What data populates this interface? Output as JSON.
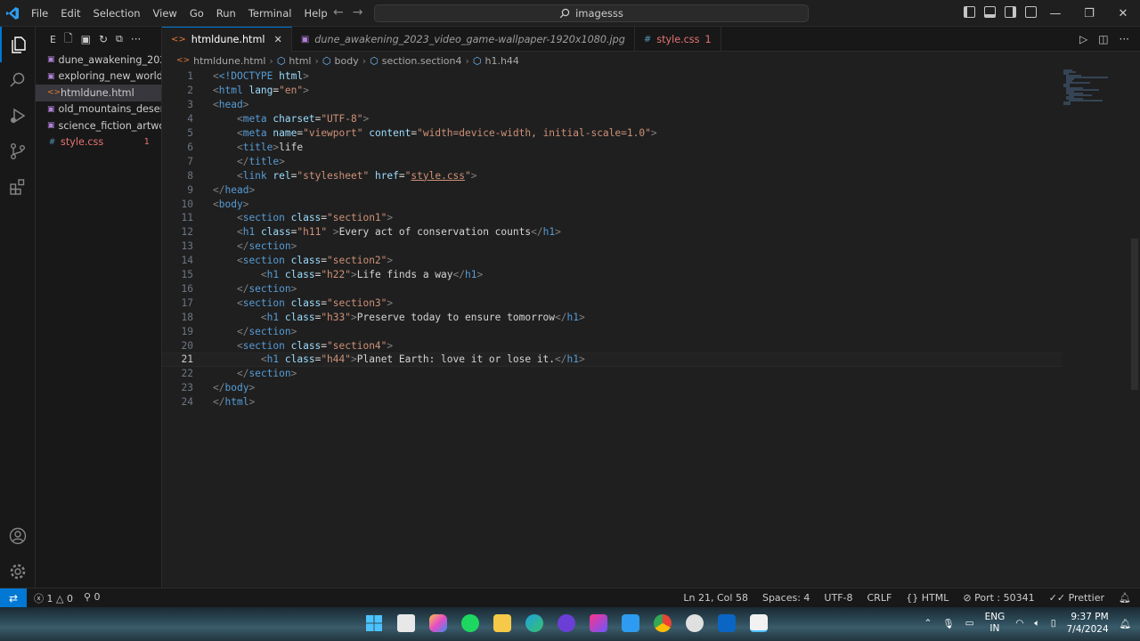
{
  "menu": [
    "File",
    "Edit",
    "Selection",
    "View",
    "Go",
    "Run",
    "Terminal",
    "Help"
  ],
  "search": {
    "text": "imagesss"
  },
  "sidebar": {
    "header_letter": "E",
    "files": [
      {
        "name": "dune_awakening_202...",
        "type": "image",
        "badge": ""
      },
      {
        "name": "exploring_new_world...",
        "type": "image",
        "badge": ""
      },
      {
        "name": "htmldune.html",
        "type": "html",
        "badge": ""
      },
      {
        "name": "old_mountains_deser...",
        "type": "image",
        "badge": ""
      },
      {
        "name": "science_fiction_artwor...",
        "type": "image",
        "badge": ""
      },
      {
        "name": "style.css",
        "type": "css",
        "badge": "1"
      }
    ]
  },
  "tabs": [
    {
      "label": "htmldune.html",
      "icon": "<>",
      "badge": ""
    },
    {
      "label": "dune_awakening_2023_video_game-wallpaper-1920x1080.jpg",
      "icon": "img",
      "badge": ""
    },
    {
      "label": "style.css",
      "icon": "#",
      "badge": "1"
    }
  ],
  "breadcrumb": [
    "htmldune.html",
    "html",
    "body",
    "section.section4",
    "h1.h44"
  ],
  "editor": {
    "current_line": 21,
    "lines": [
      {
        "n": "1"
      },
      {
        "n": "2"
      },
      {
        "n": "3"
      },
      {
        "n": "4"
      },
      {
        "n": "5"
      },
      {
        "n": "6"
      },
      {
        "n": "7"
      },
      {
        "n": "8"
      },
      {
        "n": "9"
      },
      {
        "n": "10"
      },
      {
        "n": "11"
      },
      {
        "n": "12"
      },
      {
        "n": "13"
      },
      {
        "n": "14"
      },
      {
        "n": "15"
      },
      {
        "n": "16"
      },
      {
        "n": "17"
      },
      {
        "n": "18"
      },
      {
        "n": "19"
      },
      {
        "n": "20"
      },
      {
        "n": "21"
      },
      {
        "n": "22"
      },
      {
        "n": "23"
      },
      {
        "n": "24"
      }
    ],
    "tokens": {
      "doctype": "<!DOCTYPE",
      "html_kw": "html",
      "lang_val": "\"en\"",
      "charset_val": "\"UTF-8\"",
      "viewport_val": "\"viewport\"",
      "content_val": "\"width=device-width, initial-scale=1.0\"",
      "title_text": "life",
      "stylesheet_val": "\"stylesheet\"",
      "href_val": "style.css",
      "s1": "\"section1\"",
      "h11": "\"h11\"",
      "t1": "Every act of conservation counts",
      "s2": "\"section2\"",
      "h22": "\"h22\"",
      "t2": "Life finds a way",
      "s3": "\"section3\"",
      "h33": "\"h33\"",
      "t3": "Preserve today to ensure tomorrow",
      "s4": "\"section4\"",
      "h44": "\"h44\"",
      "t4": "Planet Earth: love it or lose it."
    }
  },
  "status": {
    "errors": "1",
    "warnings": "0",
    "ports": "0",
    "position": "Ln 21, Col 58",
    "spaces": "Spaces: 4",
    "encoding": "UTF-8",
    "eol": "CRLF",
    "language": "HTML",
    "port": "Port : 50341",
    "formatter": "Prettier"
  },
  "taskbar": {
    "lang_top": "ENG",
    "lang_bottom": "IN",
    "time": "9:37 PM",
    "date": "7/4/2024"
  },
  "colors": {
    "accent": "#0078d4",
    "tag": "#569cd6",
    "attr": "#9cdcfe",
    "string": "#ce9178",
    "error": "#e57373"
  }
}
